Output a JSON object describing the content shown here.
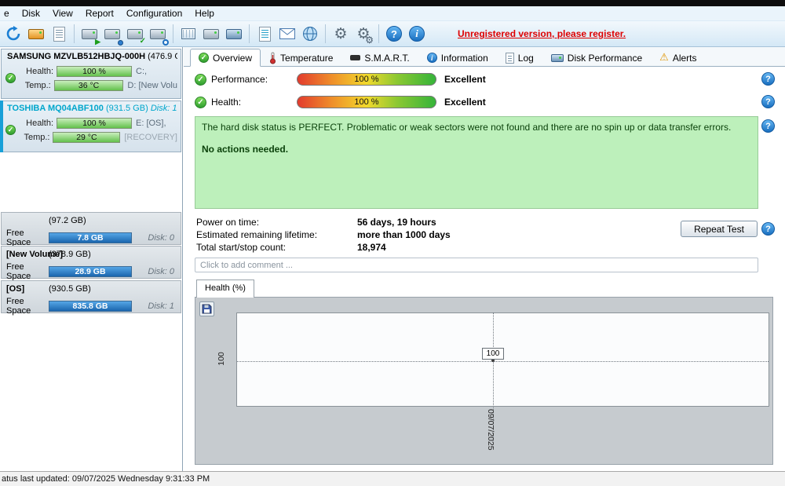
{
  "icons": {
    "check": "✓",
    "gear": "⚙",
    "warning": "⚠",
    "question": "?",
    "info": "i"
  },
  "menubar": {
    "items": [
      {
        "label": "e"
      },
      {
        "label": "Disk"
      },
      {
        "label": "View"
      },
      {
        "label": "Report"
      },
      {
        "label": "Configuration"
      },
      {
        "label": "Help"
      }
    ]
  },
  "toolbar": {
    "unregistered": "Unregistered version, please register."
  },
  "sidebar": {
    "disk0": {
      "title": "SAMSUNG MZVLB512HBJQ-000H",
      "size": "(476.9 G",
      "health_label": "Health:",
      "health_value": "100 %",
      "temp_label": "Temp.:",
      "temp_value": "36 °C",
      "drive1": "C:,",
      "drive2": "D: [New Volu"
    },
    "disk1": {
      "title": "TOSHIBA MQ04ABF100",
      "size": "(931.5 GB)",
      "disk_no": "Disk: 1",
      "health_label": "Health:",
      "health_value": "100 %",
      "temp_label": "Temp.:",
      "temp_value": "29 °C",
      "drive1": "E: [OS],",
      "drive2": "[RECOVERY]"
    },
    "partitions": [
      {
        "name": "",
        "size": "(97.2 GB)",
        "free_label": "Free Space",
        "free_value": "7.8 GB",
        "disk": "Disk: 0"
      },
      {
        "name": "[New Volume]",
        "size": "(378.9 GB)",
        "free_label": "Free Space",
        "free_value": "28.9 GB",
        "disk": "Disk: 0"
      },
      {
        "name": "[OS]",
        "size": "(930.5 GB)",
        "free_label": "Free Space",
        "free_value": "835.8 GB",
        "disk": "Disk: 1"
      }
    ]
  },
  "tabs": [
    {
      "label": "Overview"
    },
    {
      "label": "Temperature"
    },
    {
      "label": "S.M.A.R.T."
    },
    {
      "label": "Information"
    },
    {
      "label": "Log"
    },
    {
      "label": "Disk Performance"
    },
    {
      "label": "Alerts"
    }
  ],
  "overview": {
    "performance": {
      "label": "Performance:",
      "value": "100 %",
      "rating": "Excellent"
    },
    "health": {
      "label": "Health:",
      "value": "100 %",
      "rating": "Excellent"
    },
    "status_line1": "The hard disk status is PERFECT. Problematic or weak sectors were not found and there are no spin up or data transfer errors.",
    "status_line2": "No actions needed.",
    "stats": [
      {
        "label": "Power on time:",
        "value": "56 days, 19 hours"
      },
      {
        "label": "Estimated remaining lifetime:",
        "value": "more than 1000 days"
      },
      {
        "label": "Total start/stop count:",
        "value": "18,974"
      }
    ],
    "repeat_test_label": "Repeat Test",
    "comment_placeholder": "Click to add comment ..."
  },
  "chart": {
    "tab_label": "Health (%)",
    "y_tick": "100",
    "point_label": "100",
    "x_tick": "09/07/2025"
  },
  "chart_data": {
    "type": "line",
    "title": "Health (%)",
    "x": [
      "09/07/2025"
    ],
    "series": [
      {
        "name": "Health",
        "values": [
          100
        ]
      }
    ],
    "ylabel": "Health (%)",
    "yticks": [
      100
    ],
    "ylim": [
      0,
      100
    ],
    "grid": "dashed",
    "legend": "none"
  },
  "statusbar": {
    "text": "atus last updated: 09/07/2025 Wednesday 9:31:33 PM"
  }
}
